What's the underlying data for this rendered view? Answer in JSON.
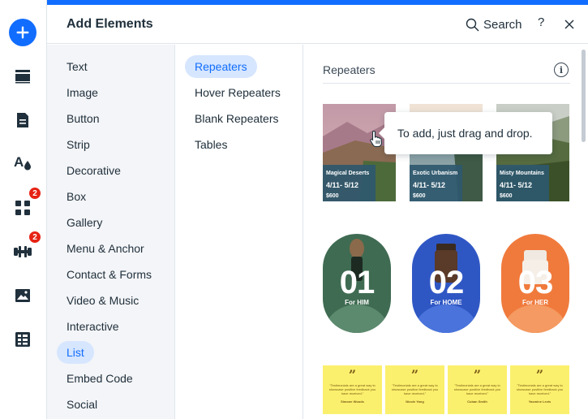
{
  "rail": {
    "items": [
      {
        "name": "add-icon"
      },
      {
        "name": "sections-icon"
      },
      {
        "name": "pages-icon"
      },
      {
        "name": "design-icon"
      },
      {
        "name": "apps-icon",
        "badge": "2"
      },
      {
        "name": "business-tools-icon",
        "badge": "2"
      },
      {
        "name": "media-icon"
      },
      {
        "name": "cms-icon"
      }
    ]
  },
  "header": {
    "title": "Add Elements",
    "search_label": "Search",
    "help_label": "?"
  },
  "categories": [
    "Text",
    "Image",
    "Button",
    "Strip",
    "Decorative",
    "Box",
    "Gallery",
    "Menu & Anchor",
    "Contact & Forms",
    "Video & Music",
    "Interactive",
    "List",
    "Embed Code",
    "Social"
  ],
  "active_category": "List",
  "subcategories": [
    "Repeaters",
    "Hover Repeaters",
    "Blank Repeaters",
    "Tables"
  ],
  "active_subcategory": "Repeaters",
  "content": {
    "section_title": "Repeaters",
    "info_label": "i",
    "tooltip": "To add, just drag and drop.",
    "cards": [
      {
        "title": "Magical Deserts",
        "date": "4/11- 5/12",
        "price": "$600"
      },
      {
        "title": "Exotic Urbanism",
        "date": "4/11- 5/12",
        "price": "$600"
      },
      {
        "title": "Misty Mountains",
        "date": "4/11- 5/12",
        "price": "$600"
      }
    ],
    "pills": [
      {
        "number": "01",
        "label": "For HIM",
        "color": "#3f6b52"
      },
      {
        "number": "02",
        "label": "For HOME",
        "color": "#2f57c4"
      },
      {
        "number": "03",
        "label": "For HER",
        "color": "#f07a3c"
      }
    ],
    "quotes": [
      {
        "mark": "”",
        "text": "\"Testimonials are a great way to showcase positive feedback you have received.\"",
        "name": "Simone Woods"
      },
      {
        "mark": "”",
        "text": "\"Testimonials are a great way to showcase positive feedback you have received.\"",
        "name": "Nicole Yang"
      },
      {
        "mark": "”",
        "text": "\"Testimonials are a great way to showcase positive feedback you have received.\"",
        "name": "Cuban Smith"
      },
      {
        "mark": "”",
        "text": "\"Testimonials are a great way to showcase positive feedback you have received.\"",
        "name": "Yasmine Levis"
      }
    ]
  },
  "colors": {
    "accent": "#116dff",
    "active_bg": "#d6e6fe",
    "badge": "#e62214",
    "panel_bg": "#f4f5f8"
  }
}
